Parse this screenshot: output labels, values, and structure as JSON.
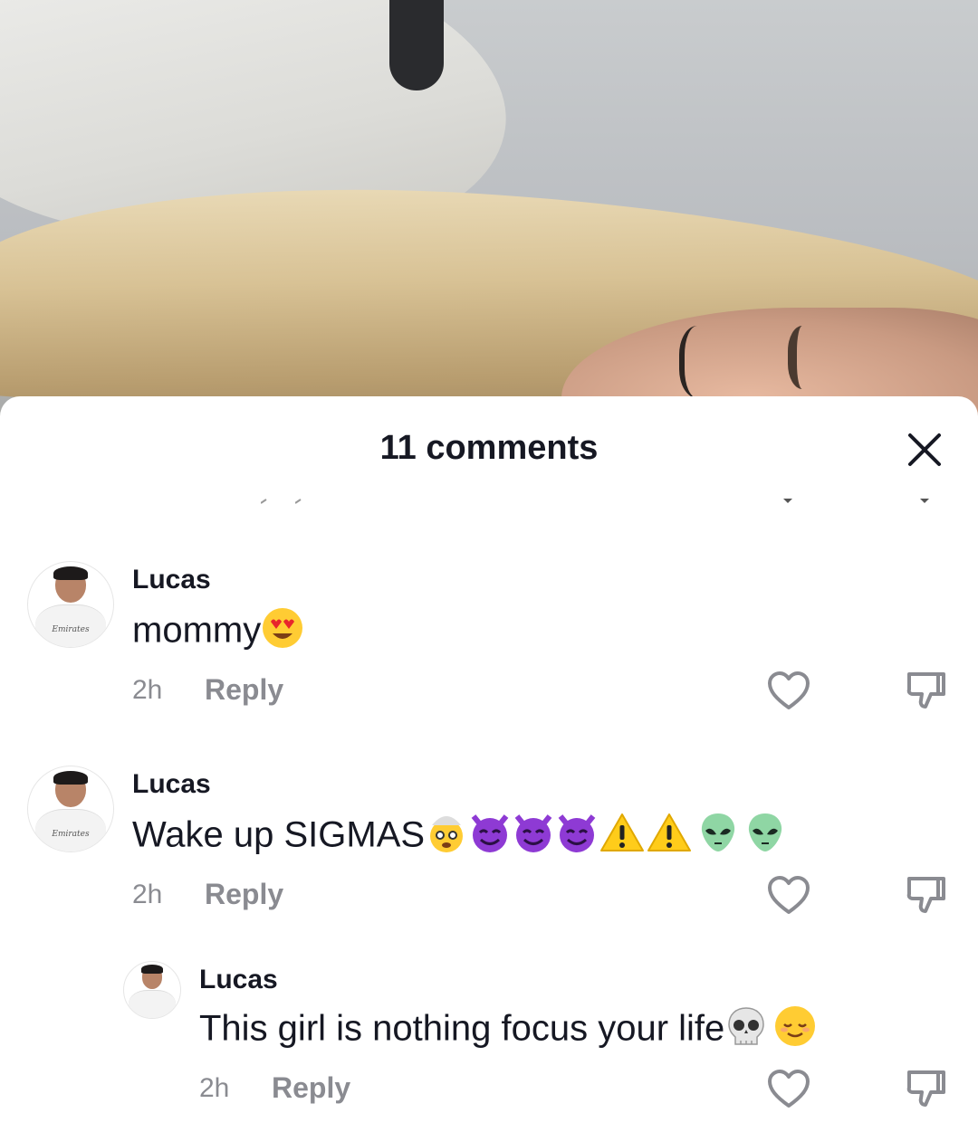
{
  "sheet": {
    "title": "11 comments",
    "close_icon": "close-icon"
  },
  "comments": [
    {
      "username": "Lucas",
      "text": "mommy",
      "emojis": [
        "heart-eyes"
      ],
      "time": "2h",
      "reply_label": "Reply"
    },
    {
      "username": "Lucas",
      "text": "Wake up SIGMAS",
      "emojis": [
        "exploding-head",
        "smiling-devil",
        "smiling-devil",
        "smiling-devil",
        "warning",
        "warning",
        "alien",
        "alien"
      ],
      "time": "2h",
      "reply_label": "Reply"
    },
    {
      "username": "Lucas",
      "text": "This girl is nothing focus your life",
      "emojis": [
        "skull",
        "relieved"
      ],
      "time": "2h",
      "reply_label": "Reply",
      "is_reply": true
    }
  ],
  "avatar_sponsor": "Emirates",
  "colors": {
    "text": "#161823",
    "muted": "#8a8b91"
  }
}
